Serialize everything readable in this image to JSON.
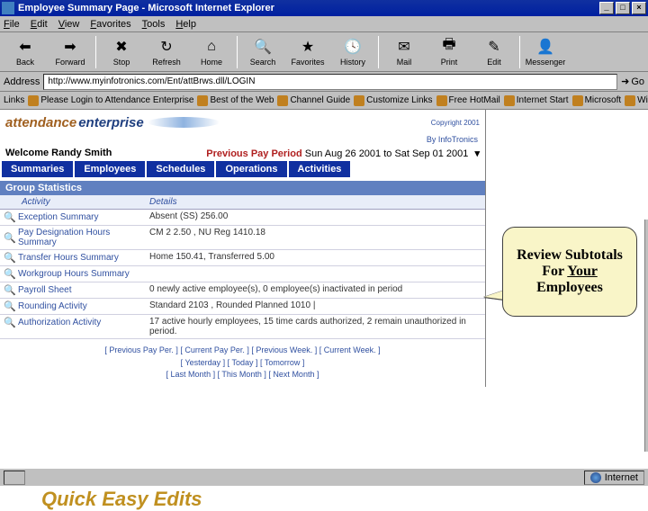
{
  "titlebar": {
    "text": "Employee Summary Page - Microsoft Internet Explorer"
  },
  "menu": {
    "items": [
      "File",
      "Edit",
      "View",
      "Favorites",
      "Tools",
      "Help"
    ]
  },
  "toolbar": {
    "back": "Back",
    "forward": "Forward",
    "stop": "Stop",
    "refresh": "Refresh",
    "home": "Home",
    "search": "Search",
    "favorites": "Favorites",
    "history": "History",
    "mail": "Mail",
    "print": "Print",
    "edit": "Edit",
    "messenger": "Messenger"
  },
  "address": {
    "label": "Address",
    "url": "http://www.myinfotronics.com/Ent/attBrws.dll/LOGIN",
    "go": "Go"
  },
  "linksbar": {
    "label": "Links",
    "items": [
      "Please Login to Attendance Enterprise",
      "Best of the Web",
      "Channel Guide",
      "Customize Links",
      "Free HotMail",
      "Internet Start",
      "Microsoft",
      "Windows Media"
    ]
  },
  "brand": {
    "part1": "attendance",
    "part2": "enterprise",
    "copyright": "Copyright 2001",
    "byline": "By InfoTronics"
  },
  "welcome": "Welcome Randy Smith",
  "payperiod": {
    "label": "Previous Pay Period",
    "range": "Sun Aug 26 2001 to Sat Sep 01 2001"
  },
  "tabs": [
    "Summaries",
    "Employees",
    "Schedules",
    "Operations",
    "Activities"
  ],
  "section": {
    "title": "Group Statistics",
    "col1": "Activity",
    "col2": "Details"
  },
  "rows": [
    {
      "activity": "Exception Summary",
      "details": "Absent (SS) 256.00"
    },
    {
      "activity": "Pay Designation Hours Summary",
      "details": "CM 2 2.50 , NU Reg 1410.18"
    },
    {
      "activity": "Transfer Hours Summary",
      "details": "Home 150.41, Transferred 5.00"
    },
    {
      "activity": "Workgroup Hours Summary",
      "details": ""
    },
    {
      "activity": "Payroll Sheet",
      "details": "0 newly active employee(s), 0 employee(s) inactivated in period"
    },
    {
      "activity": "Rounding Activity",
      "details": "Standard 2103 , Rounded Planned 1010 |"
    },
    {
      "activity": "Authorization Activity",
      "details": "17 active hourly employees, 15 time cards authorized, 2 remain unauthorized in period."
    }
  ],
  "footer": {
    "line1": "[ Previous Pay Per. ] [ Current Pay Per. ] [ Previous Week. ] [ Current Week. ]",
    "line2": "[ Yesterday ] [ Today ] [ Tomorrow ]",
    "line3": "[ Last Month ] [ This Month ] [ Next Month ]"
  },
  "callout": {
    "l1": "Review Subtotals For ",
    "under": "Your",
    "l3": " Employees"
  },
  "caption": "Quick Easy Edits",
  "status": {
    "zone": "Internet"
  }
}
